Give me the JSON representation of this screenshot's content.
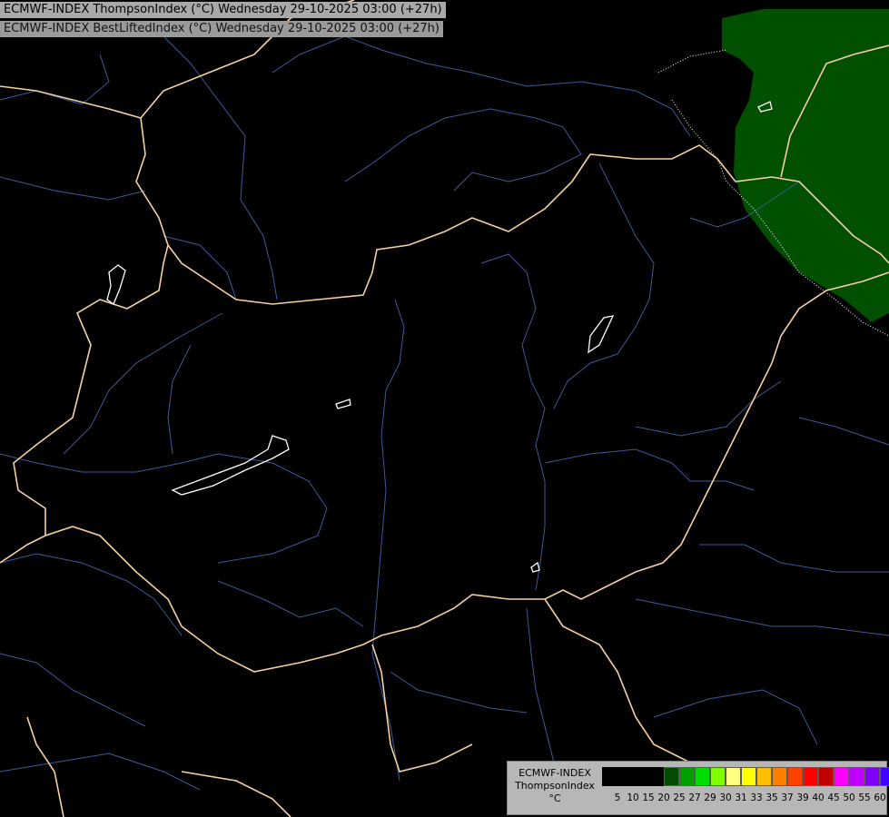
{
  "header": {
    "line1": "ECMWF-INDEX ThompsonIndex (°C) Wednesday 29-10-2025 03:00 (+27h)",
    "line2": "ECMWF-INDEX BestLiftedIndex (°C) Wednesday 29-10-2025 03:00 (+27h)"
  },
  "legend": {
    "title_line1": "ECMWF-INDEX",
    "title_line2": "ThompsonIndex",
    "title_line3": "°C",
    "colors": [
      "#000000",
      "#000000",
      "#000000",
      "#000000",
      "#004d00",
      "#00a000",
      "#00dd00",
      "#7fff00",
      "#ffff80",
      "#ffff00",
      "#ffbf00",
      "#ff8000",
      "#ff4000",
      "#ff0000",
      "#c00000",
      "#ff00ff",
      "#c000ff",
      "#8000ff",
      "#4000ff",
      "#0000ff"
    ],
    "ticks": [
      "5",
      "10",
      "15",
      "20",
      "25",
      "27",
      "29",
      "30",
      "31",
      "33",
      "35",
      "37",
      "39",
      "40",
      "45",
      "50",
      "55",
      "60"
    ]
  },
  "map": {
    "colors": {
      "border": "#f5d0a0",
      "river": "#3a5a9a",
      "lake": "#ffffff",
      "thompson_fill": "#005000",
      "lifted_index_contour": "#ffffff"
    }
  }
}
